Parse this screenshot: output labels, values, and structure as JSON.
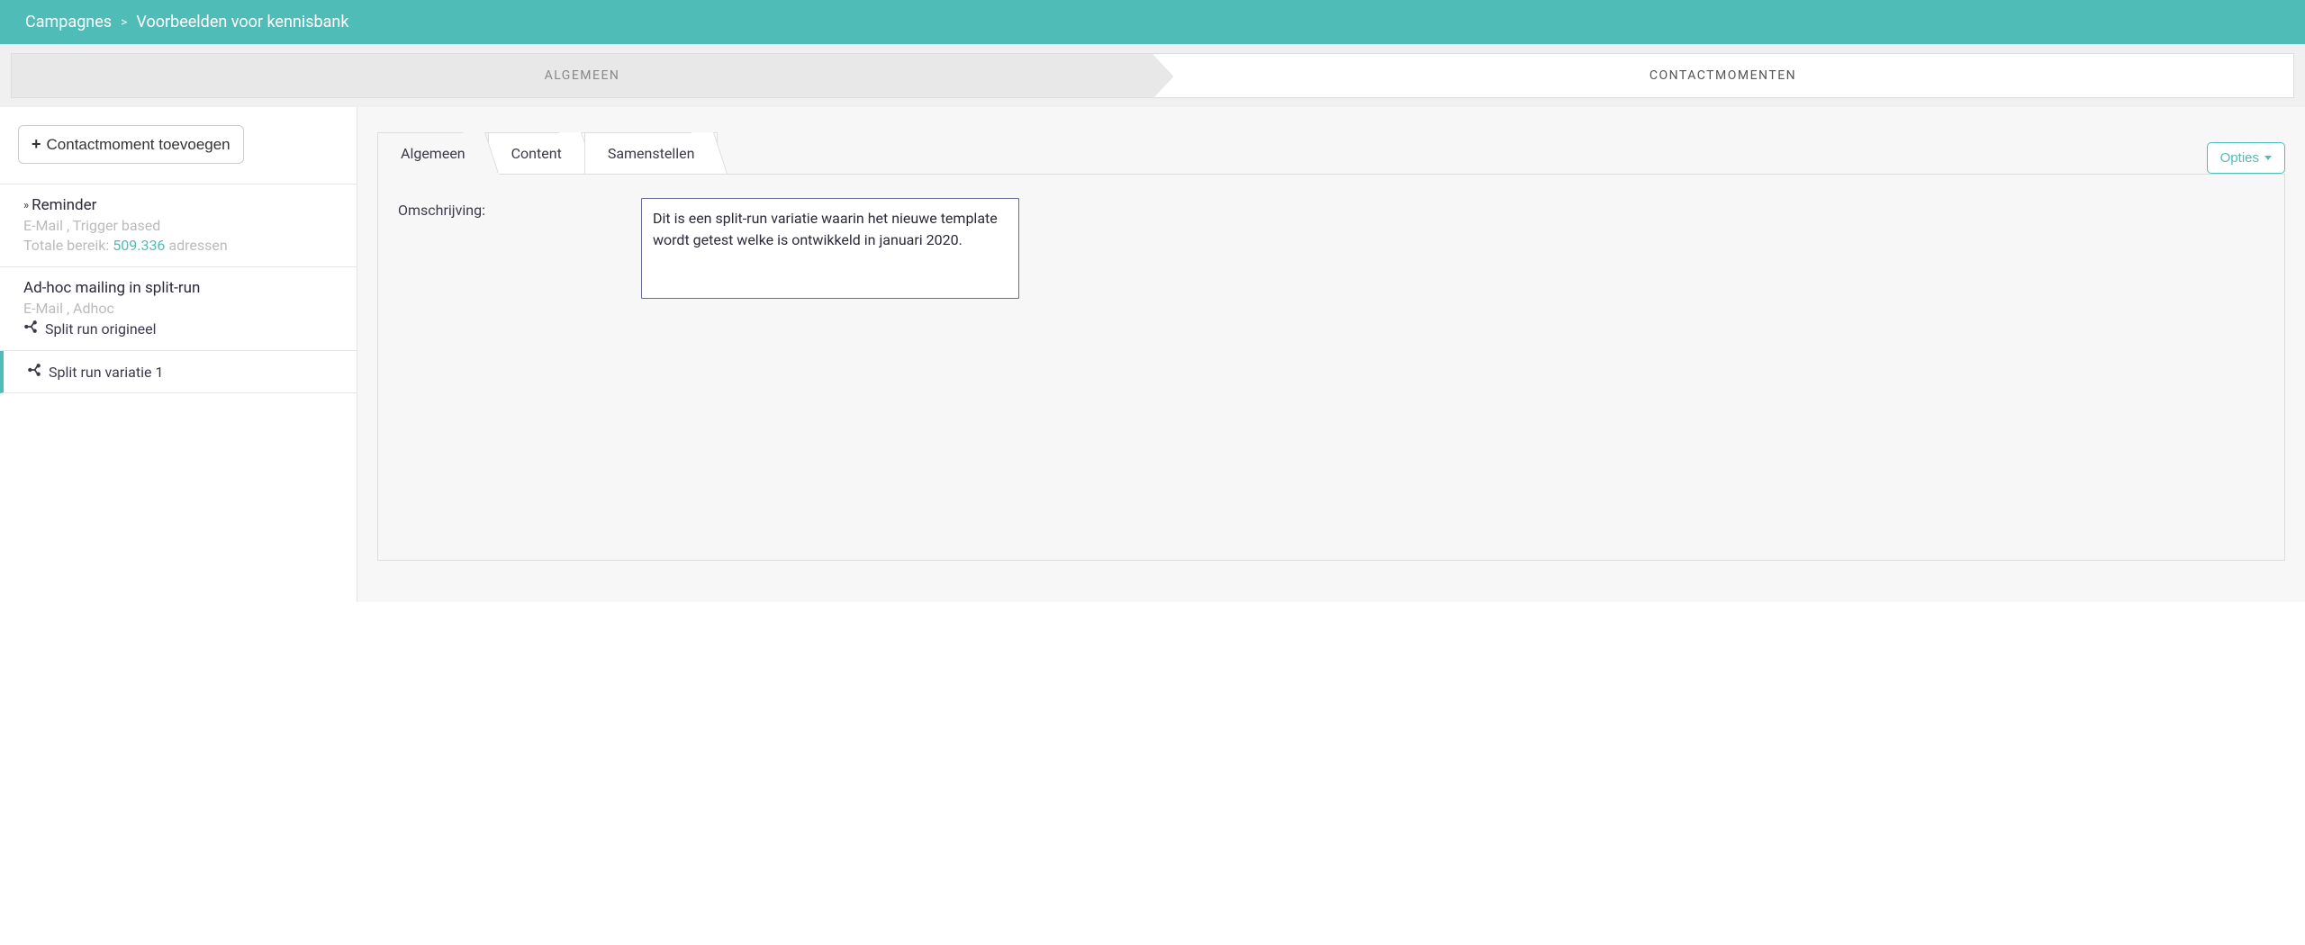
{
  "header": {
    "breadcrumb_root": "Campagnes",
    "breadcrumb_sep": ">",
    "breadcrumb_current": "Voorbeelden voor kennisbank"
  },
  "top_tabs": {
    "tab1": "ALGEMEEN",
    "tab2": "CONTACTMOMENTEN"
  },
  "sidebar": {
    "add_button": "Contactmoment toevoegen",
    "items": [
      {
        "title": "Reminder",
        "meta_line1": "E-Mail , Trigger based",
        "meta_reach_label": "Totale bereik:",
        "meta_reach_count": "509.336",
        "meta_reach_suffix": "adressen"
      },
      {
        "title": "Ad-hoc mailing in split-run",
        "meta_line1": "E-Mail , Adhoc",
        "split_original": "Split run origineel"
      }
    ],
    "split_variation": "Split run variatie 1"
  },
  "main": {
    "sub_tabs": {
      "t1": "Algemeen",
      "t2": "Content",
      "t3": "Samenstellen"
    },
    "opties_label": "Opties",
    "form": {
      "label_description": "Omschrijving:",
      "value_description": "Dit is een split-run variatie waarin het nieuwe template wordt getest welke is ontwikkeld in januari 2020."
    }
  }
}
